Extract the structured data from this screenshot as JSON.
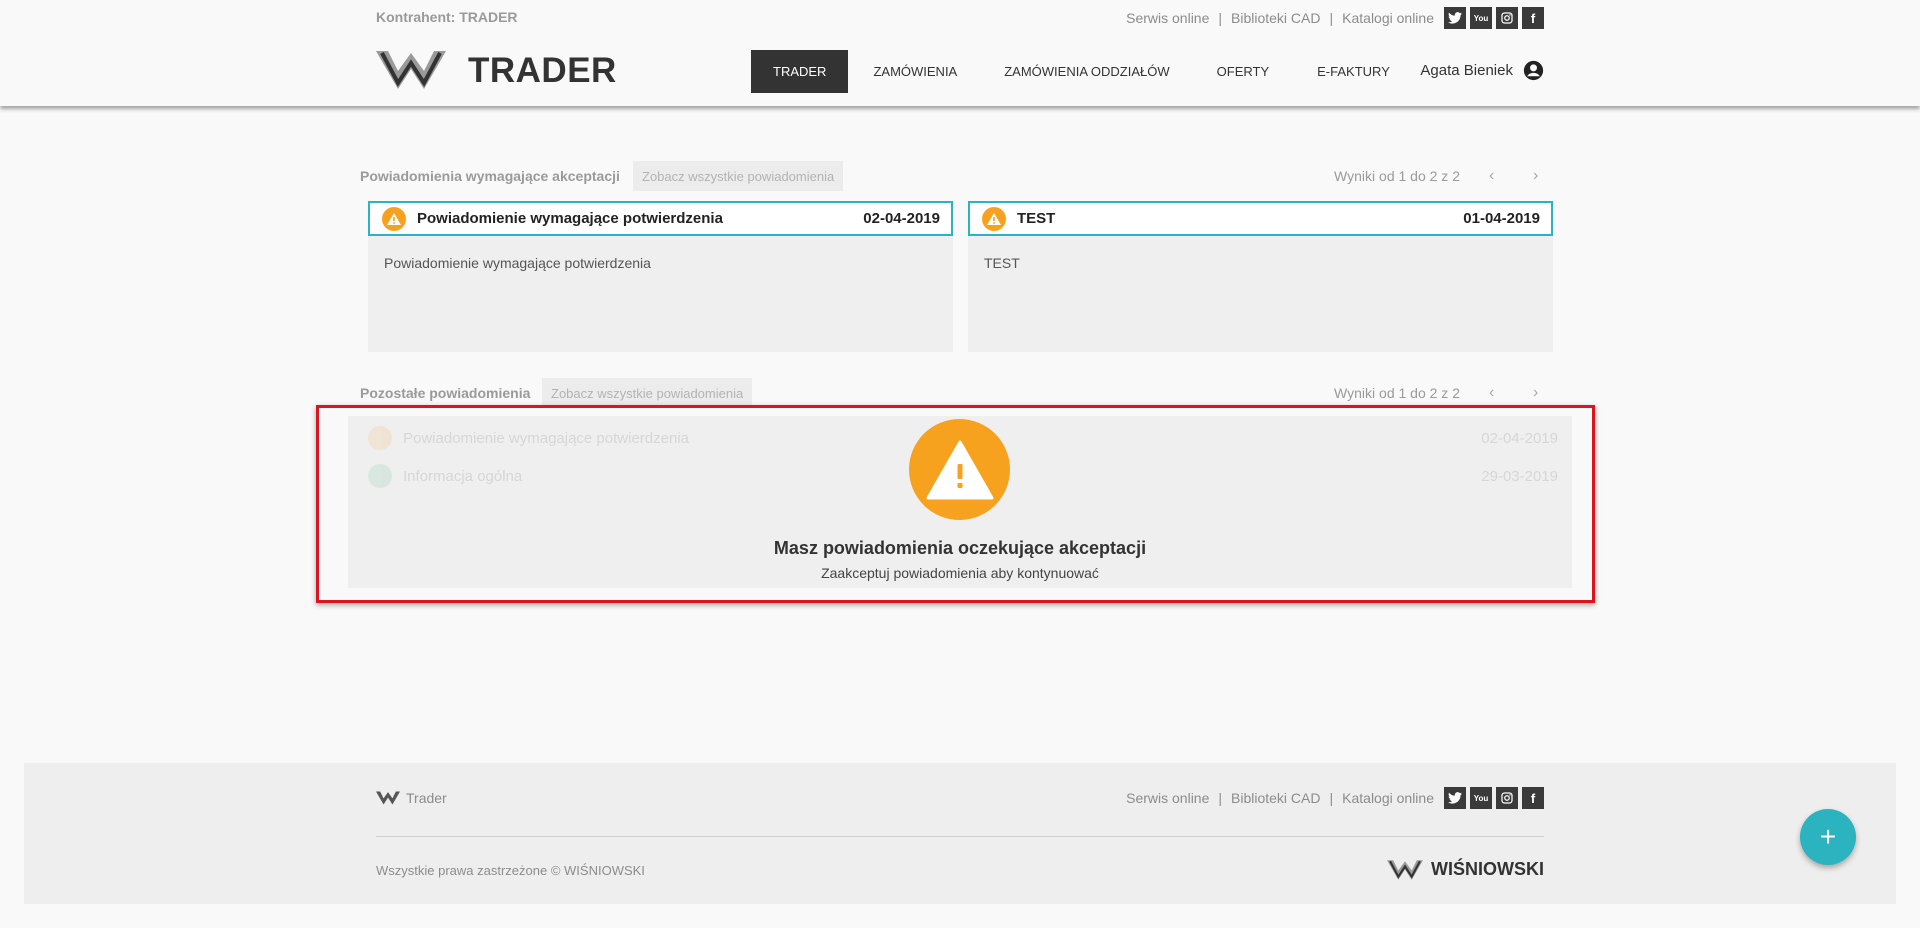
{
  "header": {
    "contractor": "Kontrahent: TRADER",
    "top_links": [
      "Serwis online",
      "Biblioteki CAD",
      "Katalogi online"
    ],
    "separator": "|",
    "social": [
      {
        "name": "twitter-icon"
      },
      {
        "name": "youtube-icon",
        "label": "You"
      },
      {
        "name": "instagram-icon"
      },
      {
        "name": "facebook-icon",
        "label": "f"
      }
    ],
    "logo_text": "TRADER",
    "nav": [
      {
        "label": "TRADER",
        "active": true
      },
      {
        "label": "ZAMÓWIENIA",
        "active": false
      },
      {
        "label": "ZAMÓWIENIA ODDZIAŁÓW",
        "active": false
      },
      {
        "label": "OFERTY",
        "active": false
      },
      {
        "label": "E-FAKTURY",
        "active": false
      }
    ],
    "user_name": "Agata Bieniek"
  },
  "required_section": {
    "title": "Powiadomienia wymagające akceptacji",
    "see_all": "Zobacz wszystkie powiadomienia",
    "results": "Wyniki od 1 do 2 z 2",
    "prev": "‹",
    "next": "›",
    "cards": [
      {
        "title": "Powiadomienie wymagające potwierdzenia",
        "date": "02-04-2019",
        "body": "Powiadomienie wymagające potwierdzenia"
      },
      {
        "title": "TEST",
        "date": "01-04-2019",
        "body": "TEST"
      }
    ]
  },
  "other_section": {
    "title": "Pozostałe powiadomienia",
    "see_all": "Zobacz wszystkie powiadomienia",
    "results": "Wyniki od 1 do 2 z 2",
    "prev": "‹",
    "next": "›",
    "rows": [
      {
        "title": "Powiadomienie wymagające potwierdzenia",
        "date": "02-04-2019",
        "icon_color": "#f6a21e"
      },
      {
        "title": "Informacja ogólna",
        "date": "29-03-2019",
        "icon_color": "#3cb878"
      }
    ]
  },
  "overlay": {
    "title": "Masz powiadomienia oczekujące akceptacji",
    "subtitle": "Zaakceptuj powiadomienia aby kontynuować"
  },
  "footer": {
    "brand": "Trader",
    "links": [
      "Serwis online",
      "Biblioteki CAD",
      "Katalogi online"
    ],
    "separator": "|",
    "copyright": "Wszystkie prawa zastrzeżone © WIŚNIOWSKI",
    "logo_text": "WIŚNIOWSKI"
  },
  "fab_label": "+",
  "colors": {
    "accent": "#2bb3c0",
    "warning": "#f6a21e",
    "highlight_frame": "#d9161f",
    "nav_active": "#333333"
  }
}
